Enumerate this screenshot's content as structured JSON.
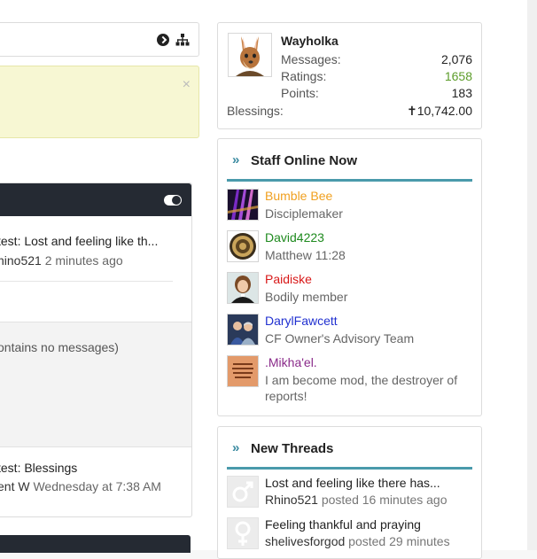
{
  "left": {
    "forum_rows": [
      {
        "title": "test: Lost and feeling like th...",
        "author": "hino521",
        "time": "2 minutes ago"
      },
      {
        "empty_text": "ontains no messages)"
      },
      {
        "title": "test: Blessings",
        "author": "ent W",
        "time": "Wednesday at 7:38 AM"
      }
    ],
    "notice_close": "×"
  },
  "user": {
    "name": "Wayholka",
    "stats": [
      {
        "label": "Messages:",
        "value": "2,076"
      },
      {
        "label": "Ratings:",
        "value": "1658"
      },
      {
        "label": "Points:",
        "value": "183"
      }
    ],
    "blessings_label": "Blessings:",
    "blessings_value": "✝10,742.00"
  },
  "staff": {
    "title": "Staff Online Now",
    "chevron": "»",
    "members": [
      {
        "name": "Bumble Bee",
        "title": "Disciplemaker",
        "color": "#f0a020"
      },
      {
        "name": "David4223",
        "title": "Matthew 11:28",
        "color": "#1e8a1e"
      },
      {
        "name": "Paidiske",
        "title": "Bodily member",
        "color": "#d81818"
      },
      {
        "name": "DarylFawcett",
        "title": "CF Owner's Advisory Team",
        "color": "#2030d0"
      },
      {
        "name": ".Mikha'el.",
        "title": "I am become mod, the destroyer of reports!",
        "color": "#8a2a8a"
      }
    ]
  },
  "threads": {
    "title": "New Threads",
    "chevron": "»",
    "items": [
      {
        "title": "Lost and feeling like there has...",
        "author": "Rhino521",
        "posted": "posted",
        "time": "16 minutes ago",
        "icon": "male-icon"
      },
      {
        "title": "Feeling thankful and praying",
        "author": "shelivesforgod",
        "posted": "posted",
        "time": "29 minutes",
        "icon": "female-icon"
      }
    ]
  },
  "colors": {
    "accent": "#4a9aab",
    "dark_header": "#252a33",
    "notice_bg": "#f7f7d3"
  }
}
